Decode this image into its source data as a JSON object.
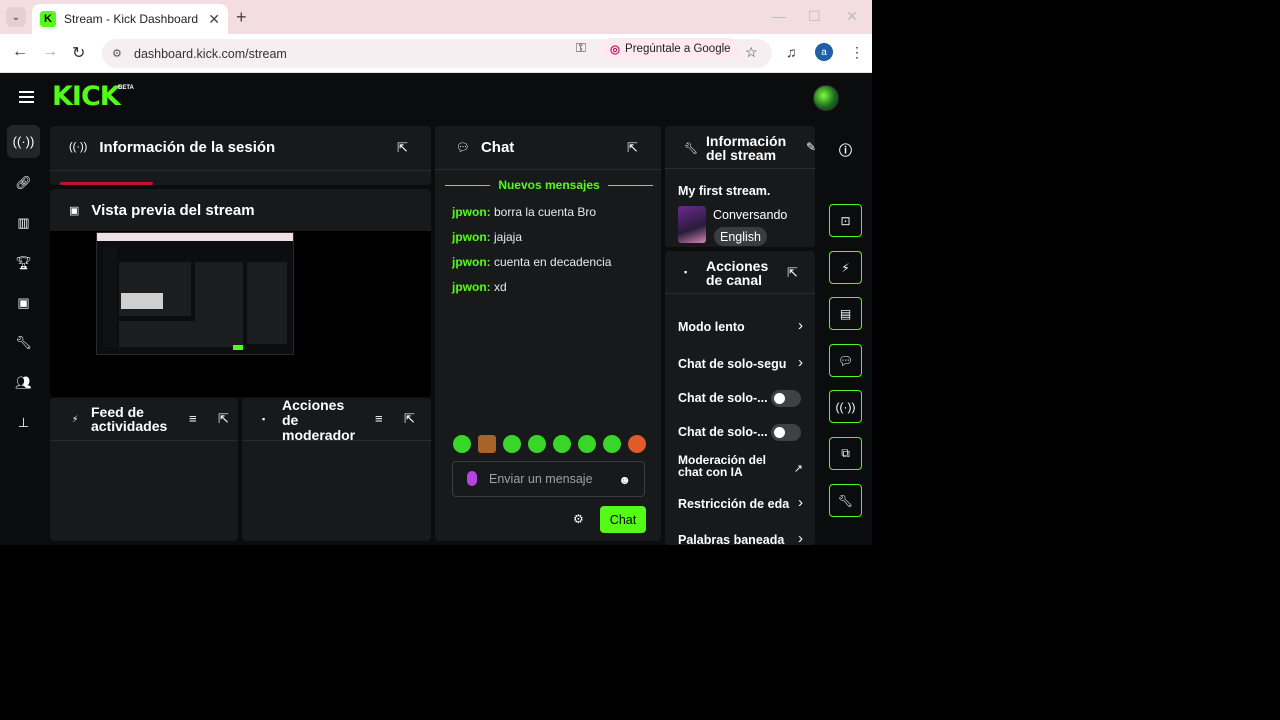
{
  "browser": {
    "tab_title": "Stream - Kick Dashboard",
    "url": "dashboard.kick.com/stream",
    "ask_google": "Pregúntale a Google",
    "profile_initial": "a",
    "tab_favicon": "K"
  },
  "header": {
    "logo": "KICK",
    "beta": "BETA"
  },
  "rail": {
    "items": [
      "broadcast-icon",
      "link-icon",
      "chart-icon",
      "trophy-icon",
      "video-icon",
      "wrench-icon",
      "users-icon",
      "stack-icon"
    ]
  },
  "session_panel": {
    "title": "Información de la sesión"
  },
  "preview_panel": {
    "title": "Vista previa del stream"
  },
  "feed_panel": {
    "title_line1": "Feed de",
    "title_line2": "actividades"
  },
  "mod_panel": {
    "title_line1": "Acciones",
    "title_line2": "de",
    "title_line3": "moderador"
  },
  "chat": {
    "title": "Chat",
    "new_messages": "Nuevos mensajes",
    "messages": [
      {
        "user": "jpwon:",
        "text": " borra la cuenta Bro"
      },
      {
        "user": "jpwon:",
        "text": " jajaja"
      },
      {
        "user": "jpwon:",
        "text": " cuenta en decadencia"
      },
      {
        "user": "jpwon:",
        "text": " xd"
      }
    ],
    "input_placeholder": "Enviar un mensaje",
    "send_label": "Chat"
  },
  "stream_info": {
    "title_line1": "Información",
    "title_line2": "del stream",
    "stream_title": "My first stream.",
    "category": "Conversando",
    "language": "English"
  },
  "channel_actions": {
    "title_line1": "Acciones",
    "title_line2": "de canal",
    "items": [
      {
        "label": "Modo lento"
      },
      {
        "label": "Chat de solo-segu"
      },
      {
        "label": "Chat de solo-..."
      },
      {
        "label": "Chat de solo-..."
      },
      {
        "label": "Moderación del",
        "label2": "chat con IA"
      },
      {
        "label": "Restricción de eda"
      },
      {
        "label": "Palabras baneada"
      }
    ]
  },
  "right_rail": {
    "items": [
      "info-icon",
      "screen-capture-icon",
      "lightning-icon",
      "document-icon",
      "chat-bubble-icon",
      "broadcast-icon",
      "split-screen-icon",
      "wrench-icon"
    ]
  },
  "colors": {
    "accent": "#53fc18",
    "panel": "#18191b",
    "background": "#0b0c0d"
  }
}
